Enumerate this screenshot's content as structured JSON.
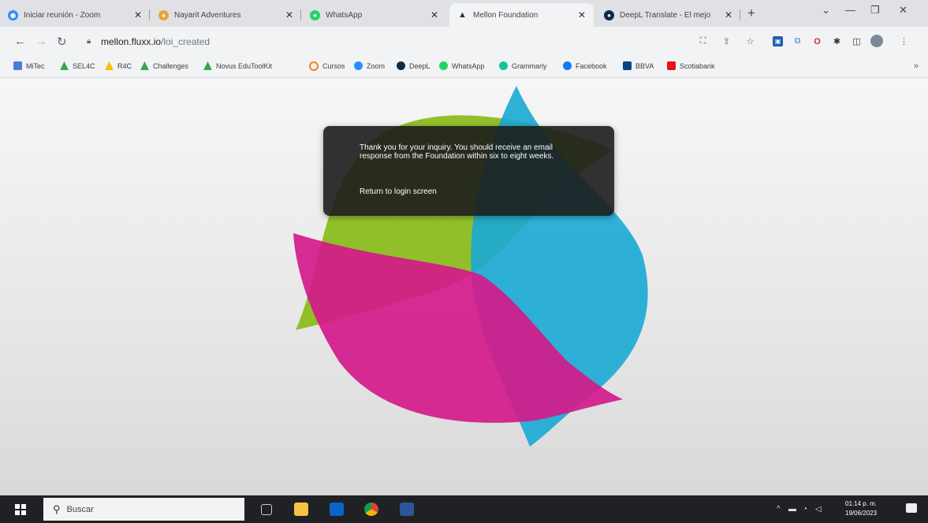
{
  "browser": {
    "tabs": [
      {
        "title": "Iniciar reunión - Zoom",
        "icon": "zoom-icon",
        "color": "#2d8cff",
        "active": false
      },
      {
        "title": "Nayarit Adventures",
        "icon": "location-pin-icon",
        "color": "#e8a33d",
        "active": false
      },
      {
        "title": "WhatsApp",
        "icon": "whatsapp-icon",
        "color": "#25d366",
        "active": false
      },
      {
        "title": "Mellon Foundation",
        "icon": "mellon-icon",
        "color": "#2d3a2e",
        "active": true
      },
      {
        "title": "DeepL Translate - El mejo",
        "icon": "deepl-icon",
        "color": "#0f2b46",
        "active": false
      }
    ],
    "new_tab_label": "+",
    "url_host": "mellon.fluxx.io",
    "url_path": "/loi_created",
    "bookmarks": [
      {
        "label": "MiTec",
        "color": "#4a7dd6"
      },
      {
        "label": "SEL4C",
        "color": "#34a853"
      },
      {
        "label": "R4C",
        "color": "#fbbc04"
      },
      {
        "label": "Challenges",
        "color": "#34a853"
      },
      {
        "label": "Novus EduToolKit",
        "color": "#34a853"
      },
      {
        "label": "Cursos",
        "color": "#f4811f"
      },
      {
        "label": "Zoom",
        "color": "#2d8cff"
      },
      {
        "label": "DeepL",
        "color": "#0f2b46"
      },
      {
        "label": "WhatsApp",
        "color": "#25d366"
      },
      {
        "label": "Grammarly",
        "color": "#15c39a"
      },
      {
        "label": "Facebook",
        "color": "#1877f2"
      },
      {
        "label": "BBVA",
        "color": "#004481"
      },
      {
        "label": "Scotiabank",
        "color": "#ec111a"
      }
    ]
  },
  "dialog": {
    "message": "Thank you for your inquiry. You should receive an email response from the Foundation within six to eight weeks.",
    "link": "Return to login screen"
  },
  "taskbar": {
    "search_placeholder": "Buscar",
    "time": "01:14 p. m.",
    "date": "19/06/2023"
  },
  "colors": {
    "green_petal": "#8cbd1f",
    "cyan_petal": "#19a9d4",
    "magenta_petal": "#d31a8a",
    "dialog_bg": "#1c1c1c"
  }
}
